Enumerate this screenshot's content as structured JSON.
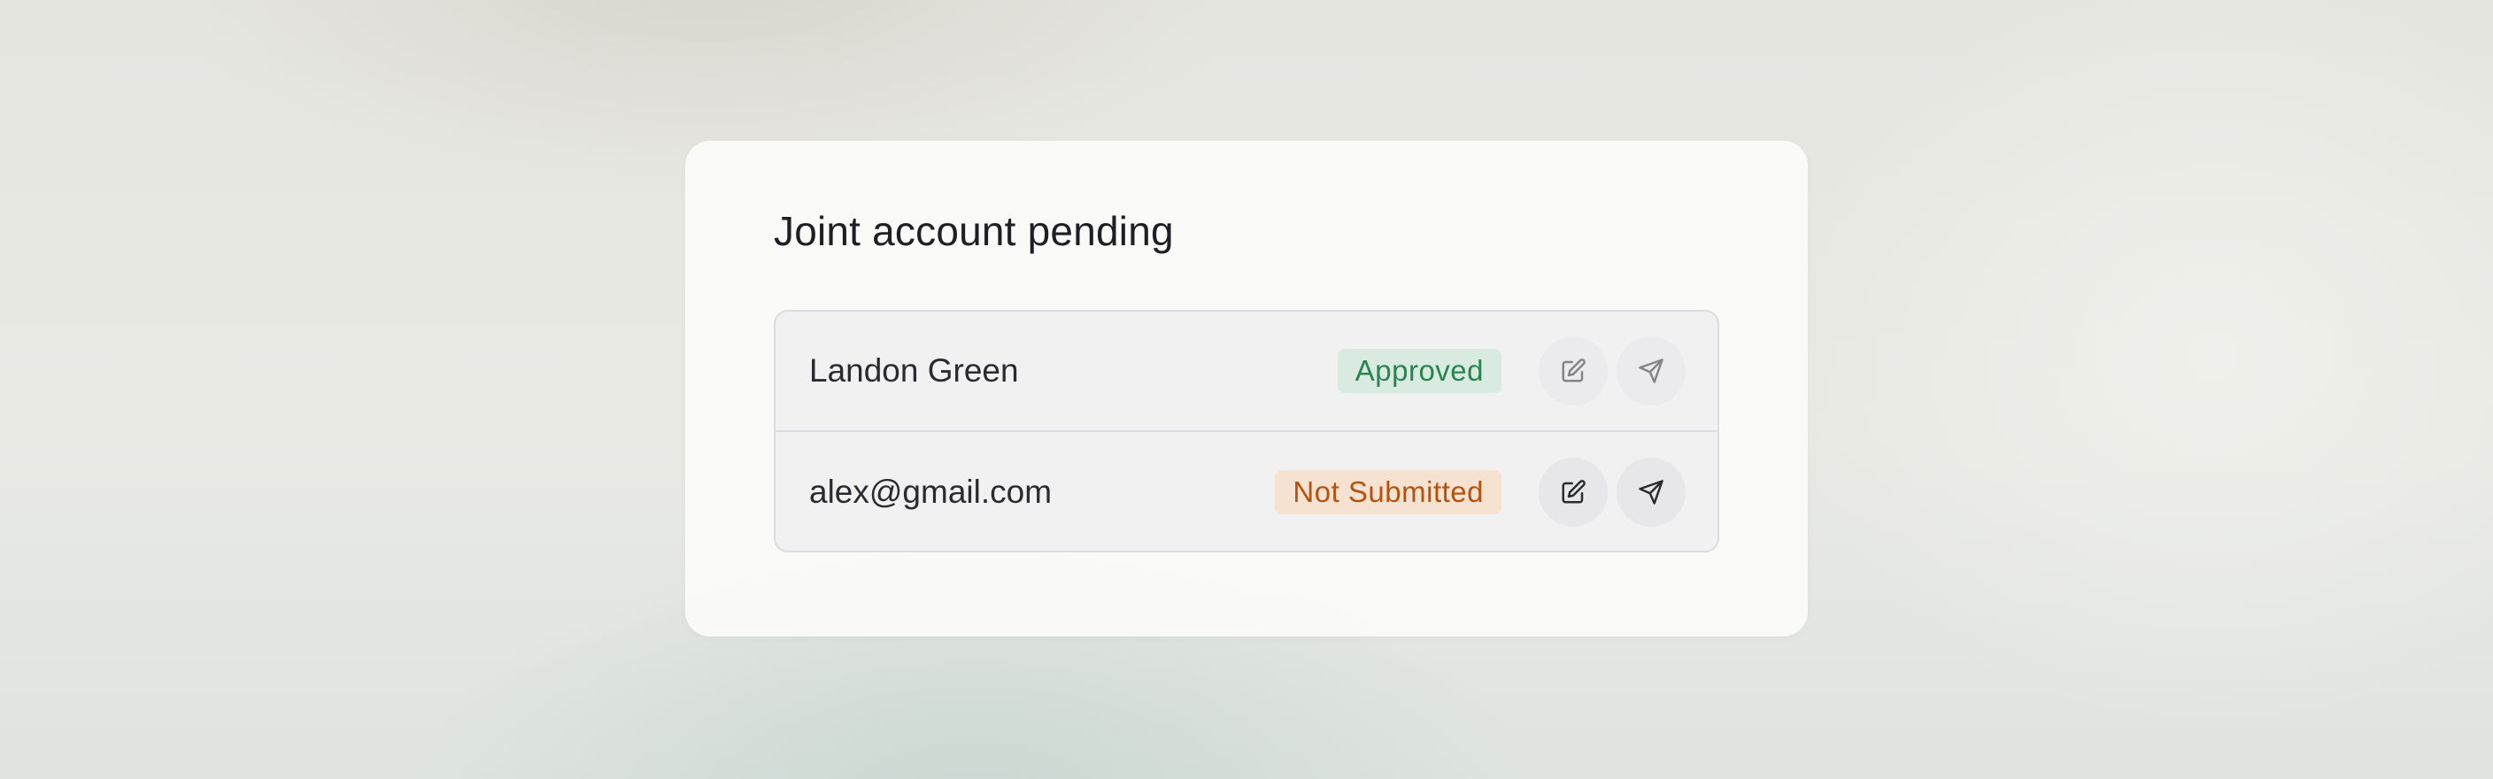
{
  "card": {
    "title": "Joint account pending"
  },
  "rows": [
    {
      "name": "Landon Green",
      "status": "Approved",
      "status_color": "#2a8450",
      "status_bg": "#d9ebe0",
      "actions": [
        {
          "icon": "edit-icon",
          "enabled": false
        },
        {
          "icon": "send-icon",
          "enabled": false
        }
      ]
    },
    {
      "name": "alex@gmail.com",
      "status": "Not Submitted",
      "status_color": "#b5520f",
      "status_bg": "#f6e2d1",
      "actions": [
        {
          "icon": "edit-icon",
          "enabled": true
        },
        {
          "icon": "send-icon",
          "enabled": true
        }
      ]
    }
  ]
}
